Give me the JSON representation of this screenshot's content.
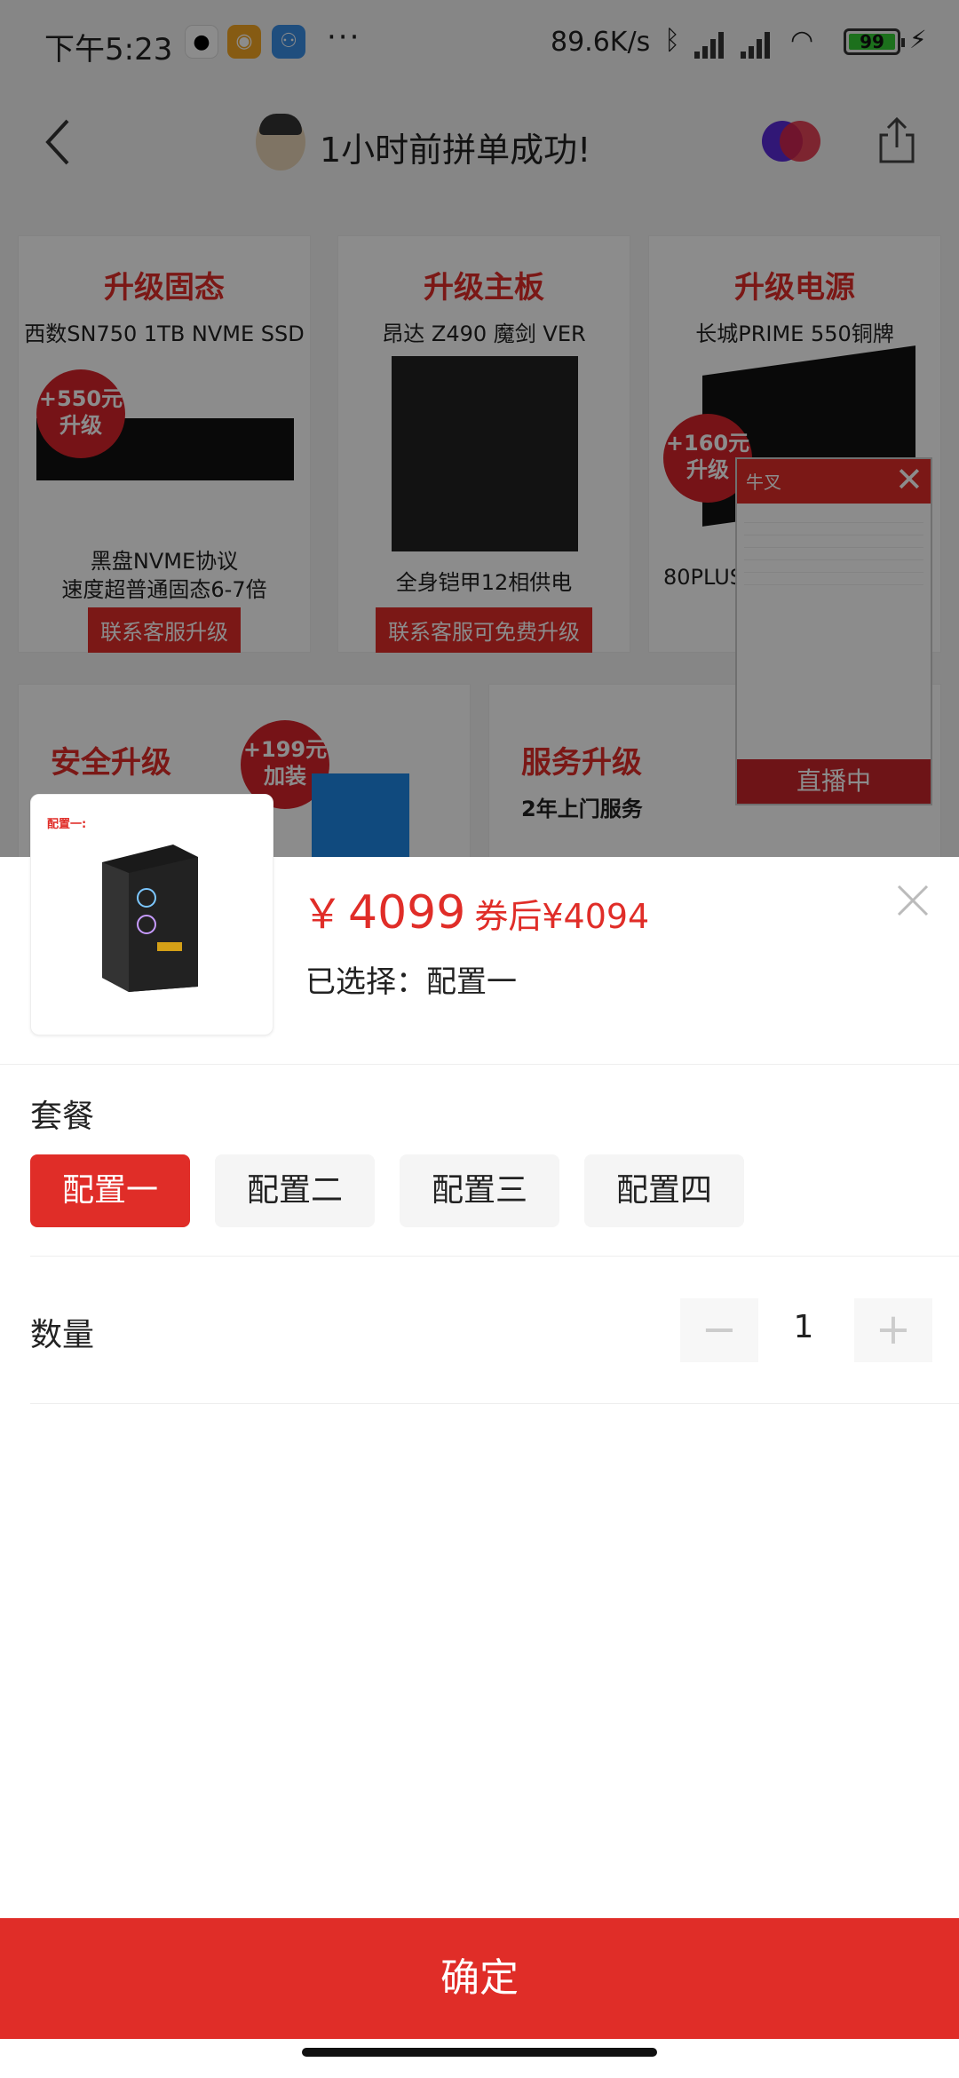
{
  "status_bar": {
    "time": "下午5:23",
    "more": "···",
    "net_speed": "89.6K/s",
    "battery": "99",
    "icons": [
      "qq-icon",
      "weibo-icon",
      "app-icon",
      "bluetooth-icon",
      "signal-icon",
      "hd-signal-icon",
      "wifi-icon",
      "battery-icon",
      "charging-icon"
    ]
  },
  "header": {
    "title": "1小时前拼单成功!",
    "icons": [
      "back-icon",
      "avatar",
      "brand-logo-icon",
      "share-icon"
    ]
  },
  "background_cards": [
    {
      "heading": "升级固态",
      "sub": "西数SN750 1TB NVME SSD",
      "badge": "+550元\n升级",
      "note": "黑盘NVME协议\n速度超普通固态6-7倍",
      "button": "联系客服升级"
    },
    {
      "heading": "升级主板",
      "sub": "昂达 Z490 魔剑 VER",
      "note": "全身铠甲12相供电",
      "button": "联系客服可免费升级"
    },
    {
      "heading": "升级电源",
      "sub": "长城PRIME 550铜牌",
      "badge": "+160元\n升级",
      "note": "80PLUS"
    },
    {
      "heading": "安全升级",
      "badge": "+199元\n加装"
    },
    {
      "heading": "服务升级",
      "sub": "2年上门服务"
    }
  ],
  "live_widget": {
    "label": "直播中"
  },
  "product": {
    "thumb_tag": "配置一:",
    "currency": "￥",
    "price": "4099",
    "coupon_price": "券后¥4094",
    "selected_label": "已选择：",
    "selected_value": "配置一"
  },
  "package": {
    "label": "套餐",
    "options": [
      "配置一",
      "配置二",
      "配置三",
      "配置四"
    ],
    "active_index": 0
  },
  "quantity": {
    "label": "数量",
    "minus": "−",
    "value": "1",
    "plus": "+"
  },
  "confirm_label": "确定",
  "colors": {
    "accent": "#e02d28",
    "option_bg": "#f5f5f5",
    "overlay": "rgba(0,0,0,0.45)"
  }
}
